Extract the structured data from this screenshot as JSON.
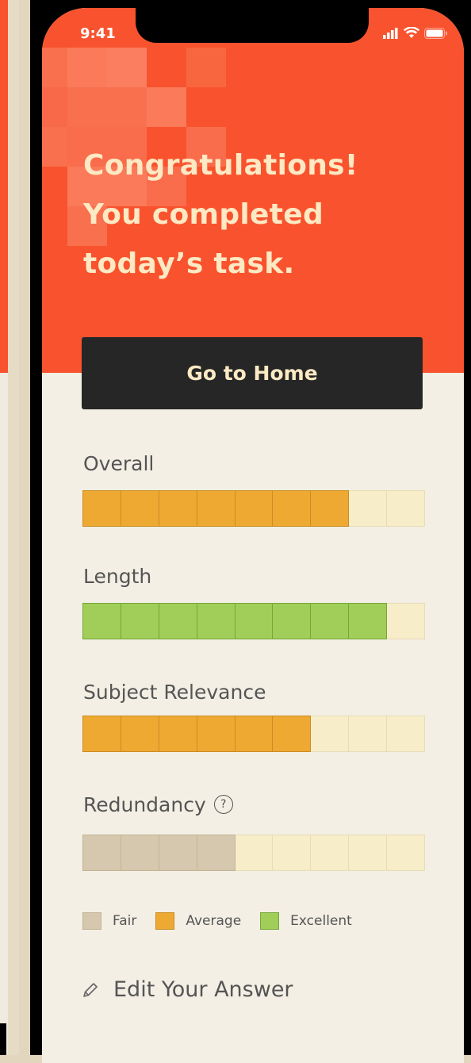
{
  "status_bar": {
    "time": "9:41"
  },
  "hero": {
    "line1": "Congratulations!",
    "line2": "You completed",
    "line3": "today’s task."
  },
  "actions": {
    "home_label": "Go to Home"
  },
  "metrics": [
    {
      "label": "Overall",
      "filled": 7,
      "total": 9,
      "rating": "Average"
    },
    {
      "label": "Length",
      "filled": 8,
      "total": 9,
      "rating": "Excellent"
    },
    {
      "label": "Subject Relevance",
      "filled": 6,
      "total": 9,
      "rating": "Average"
    },
    {
      "label": "Redundancy",
      "filled": 4,
      "total": 9,
      "rating": "Fair"
    }
  ],
  "legend": [
    {
      "label": "Fair",
      "color": "#d6c8ae"
    },
    {
      "label": "Average",
      "color": "#eea933"
    },
    {
      "label": "Excellent",
      "color": "#a0ce58"
    }
  ],
  "colors": {
    "accent": "#f8532e",
    "dark_button": "#262626",
    "cream_text": "#fde9c3",
    "empty_segment": "#f7edc9"
  },
  "edit": {
    "label": "Edit Your Answer",
    "icon": "pencil-icon"
  }
}
